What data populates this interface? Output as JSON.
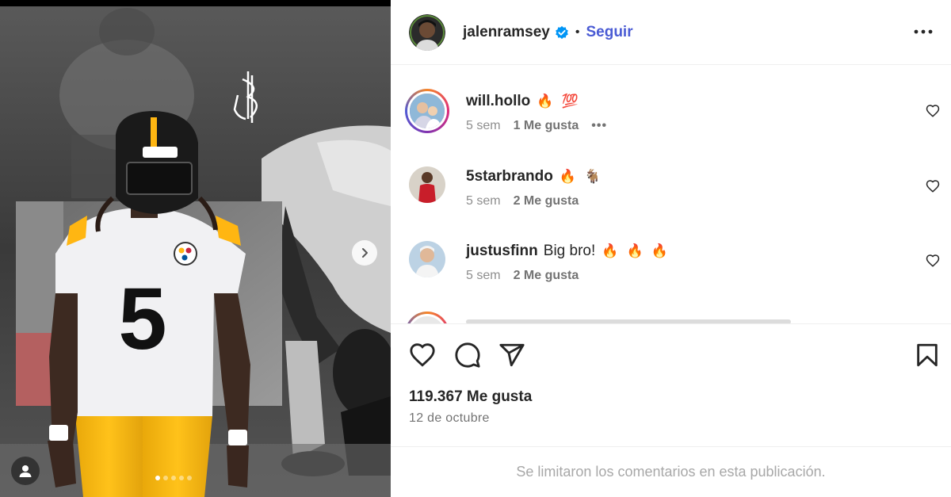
{
  "header": {
    "username": "jalenramsey",
    "separator": "•",
    "follow_label": "Seguir",
    "more_icon": "more-horizontal-icon"
  },
  "media": {
    "dots_count": 5,
    "active_dot": 1
  },
  "comments": [
    {
      "username": "will.hollo",
      "text": "",
      "emoji": [
        "🔥",
        "💯"
      ],
      "time": "5 sem",
      "likes": "1 Me gusta",
      "show_more": true
    },
    {
      "username": "5starbrando",
      "text": "",
      "emoji": [
        "🔥",
        "🐐"
      ],
      "time": "5 sem",
      "likes": "2 Me gusta",
      "show_more": false
    },
    {
      "username": "justusfinn",
      "text": "Big bro!",
      "emoji": [
        "🔥",
        "🔥",
        "🔥"
      ],
      "time": "5 sem",
      "likes": "2 Me gusta",
      "show_more": false
    }
  ],
  "post": {
    "likes": "119.367 Me gusta",
    "date": "12 de octubre",
    "comments_limited": "Se limitaron los comentarios en esta publicación."
  },
  "colors": {
    "accent": "#4a5bd4",
    "verified": "#0095f6",
    "steelers_yellow": "#ffb612"
  }
}
